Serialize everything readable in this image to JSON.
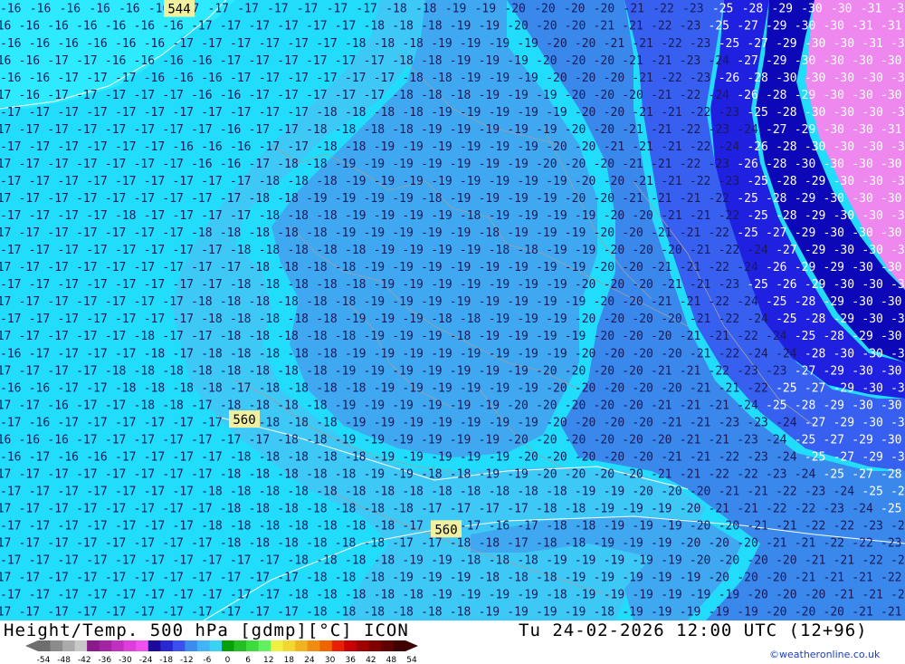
{
  "footer": {
    "title": "Height/Temp. 500 hPa [gdmp][°C] ICON",
    "datetime": "Tu 24-02-2026 12:00 UTC (12+96)",
    "credit": "©weatheronline.co.uk"
  },
  "colors": {
    "t16": "#2eeaff",
    "t18": "#3ec8f6",
    "t19": "#40a8f0",
    "t20": "#3a88ec",
    "t22": "#3860f0",
    "t25": "#2020e0",
    "t28": "#0c08b8",
    "t30": "#ee88ee",
    "contour": "#ffffff",
    "border": "#a0a0a0",
    "label_box": "#f0f0a0"
  },
  "legend": {
    "ticks": [
      "-54",
      "-48",
      "-42",
      "-36",
      "-30",
      "-24",
      "-18",
      "-12",
      "-6",
      "0",
      "6",
      "12",
      "18",
      "24",
      "30",
      "36",
      "42",
      "48",
      "54"
    ],
    "swatches": [
      "#6e6e6e",
      "#8c8c8c",
      "#aaaaaa",
      "#c8c8c8",
      "#8a1a8a",
      "#a224a2",
      "#c030c0",
      "#de3ede",
      "#f050f0",
      "#1e0a9a",
      "#2828d0",
      "#3c50f0",
      "#3c8cf0",
      "#40b4f4",
      "#3ad2f2",
      "#08a008",
      "#22c022",
      "#3cdc3c",
      "#60f060",
      "#f0f040",
      "#f0d830",
      "#f0b420",
      "#f08c10",
      "#f06400",
      "#e82000",
      "#c80000",
      "#a00000",
      "#800000",
      "#600000",
      "#400000"
    ]
  },
  "map": {
    "contour_labels": [
      {
        "label": "544",
        "xr": 0.198,
        "yr": 0.014
      },
      {
        "label": "560",
        "xr": 0.27,
        "yr": 0.676
      },
      {
        "label": "560",
        "xr": 0.493,
        "yr": 0.853
      }
    ],
    "rows": [
      "16 16 16 16 16 16 17 17 17 17 17 17 17 18 18 19 19 20 20 20 20 21 22 23 25 28 29 30 30 31 30",
      "16 16 16 16 16 16 16 17 17 17 17 17 17 18 18 18 19 19 20 20 20 21 21 22 23 25 27 29 30 30 31 31",
      "16 16 16 16 16 16 17 17 17 17 17 17 18 18 18 19 19 19 19 20 20 21 21 22 23 25 27 29 30 30 31 30",
      "16 16 17 17 16 16 16 16 17 17 17 17 17 17 18 18 19 19 19 20 20 20 21 21 23 24 27 29 30 30 30 30",
      "16 16 17 17 17 16 16 16 17 17 17 17 17 17 18 18 19 19 19 20 20 20 21 22 23 26 28 30 30 30 30 30",
      "17 16 17 17 17 17 17 16 16 17 17 17 17 17 18 18 18 19 19 19 20 20 20 21 22 24 26 28 29 30 30 30",
      "17 17 17 17 17 17 17 17 17 17 17 18 18 18 18 19 19 19 19 19 20 20 21 21 22 23 25 28 30 30 30 30",
      "17 17 17 17 17 17 17 17 16 17 17 18 18 18 18 19 19 19 19 19 20 20 21 21 22 23 24 27 29 30 30 31",
      "17 17 17 17 17 17 16 16 16 17 17 18 18 19 19 19 19 19 19 20 20 21 21 21 22 24 26 28 30 30 30 30",
      "17 17 17 17 17 17 17 16 16 17 18 18 19 19 19 19 19 19 19 20 20 20 21 21 22 23 26 28 30 30 30 30",
      "17 17 17 17 17 17 17 17 17 18 18 18 19 19 19 19 19 19 19 19 20 20 21 21 22 23 25 28 29 30 30 30",
      "17 17 17 17 17 17 17 17 17 18 18 19 19 19 19 18 19 19 19 19 20 20 21 21 21 22 25 28 29 30 30 30",
      "17 17 17 17 18 17 17 17 17 18 18 18 19 19 19 19 18 19 19 19 19 20 20 21 21 22 25 28 29 30 30 30",
      "17 17 17 17 17 17 17 18 18 18 18 18 19 19 19 19 19 18 19 19 19 20 20 21 21 22 25 27 29 30 30 30",
      "17 17 17 17 17 17 17 17 18 18 18 18 18 19 19 19 19 18 18 19 19 20 20 20 21 22 24 27 29 30 30 30",
      "17 17 17 17 17 17 17 17 17 18 18 18 18 19 19 19 19 19 19 19 19 20 20 21 21 22 24 26 29 29 30 30",
      "17 17 17 17 17 17 17 17 18 18 18 18 18 19 19 19 19 19 19 19 20 20 20 21 21 23 25 26 29 30 30 30",
      "17 17 17 17 17 17 17 18 18 18 18 18 18 19 19 19 19 19 19 19 19 20 20 21 21 22 24 25 28 29 30 30",
      "17 17 17 17 17 17 17 18 18 18 18 18 19 19 19 18 18 19 19 19 20 20 20 20 21 22 24 25 28 29 30 30",
      "17 17 17 17 17 18 17 17 18 18 18 18 18 19 19 19 18 19 19 19 19 20 20 20 21 21 22 24 25 28 29 30",
      "16 17 17 17 17 18 17 18 18 18 18 18 19 19 19 19 19 19 19 19 20 20 20 20 21 22 24 24 28 30 30 30",
      "17 17 17 17 18 18 18 18 18 18 18 18 19 19 19 19 19 19 19 20 20 20 20 21 21 22 23 23 27 29 30 30",
      "16 16 17 17 18 18 18 18 17 18 18 18 18 19 19 19 19 19 19 20 20 20 20 20 21 21 22 25 27 29 30 30",
      "17 17 16 17 17 18 18 17 18 18 18 18 19 19 19 19 19 19 20 20 20 20 20 21 21 21 24 25 28 29 30 30",
      "17 16 17 17 17 17 17 17 18 18 18 18 19 19 19 19 19 19 19 20 20 20 20 21 21 23 23 24 27 29 30 30",
      "16 16 16 17 17 17 17 17 17 17 18 18 19 19 19 19 19 19 20 20 20 20 20 20 21 21 23 24 25 27 29 30",
      "16 17 16 16 17 17 17 17 18 18 18 18 18 19 19 19 19 19 20 20 20 20 20 21 21 22 23 24 25 27 29 30",
      "17 17 17 17 17 17 17 17 18 18 18 18 18 19 19 18 18 19 19 20 20 20 20 21 21 22 22 23 24 25 27 28",
      "17 17 17 17 17 17 17 18 18 18 18 18 18 18 18 18 18 18 18 18 19 19 20 20 20 21 21 22 23 24 25 27",
      "17 17 17 17 17 17 17 17 18 18 18 18 18 18 18 17 17 17 17 18 18 19 19 19 20 21 21 22 22 23 24 25",
      "17 17 17 17 17 17 17 18 18 18 18 18 18 18 17 17 17 16 17 18 18 19 19 19 20 20 21 21 22 22 23 24",
      "17 17 17 17 17 17 17 17 18 18 18 18 18 18 17 17 18 18 17 18 18 19 19 19 20 20 20 21 21 22 22 23",
      "17 17 17 17 17 17 17 17 17 17 18 18 18 18 19 19 18 18 18 19 19 19 19 19 20 20 20 20 21 21 22 22",
      "17 17 17 17 17 17 17 17 17 17 17 18 18 18 19 19 19 18 18 18 19 19 19 19 19 20 20 20 21 21 21 22",
      "17 17 17 17 17 17 17 17 17 17 18 18 18 18 18 19 19 19 19 18 19 19 19 19 19 19 20 20 20 21 21 21",
      "17 17 17 17 17 17 17 17 17 17 17 18 18 18 18 18 18 19 19 19 19 18 19 19 19 19 19 20 20 20 21 21"
    ]
  }
}
